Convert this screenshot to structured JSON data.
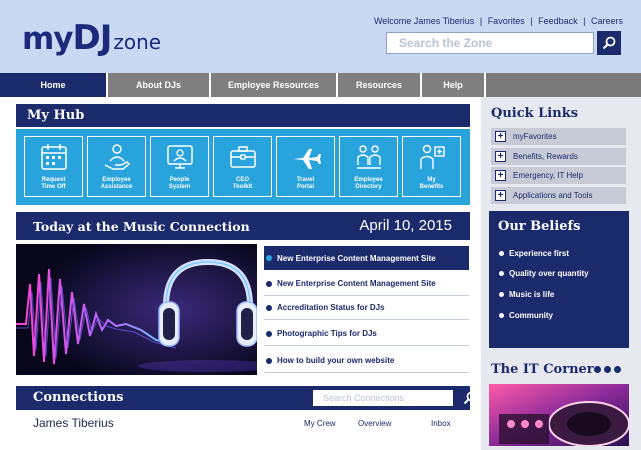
{
  "header": {
    "logo": {
      "my": "my",
      "dj": "DJ",
      "zone": "zone"
    },
    "welcome": "Welcome James Tiberius",
    "links": [
      "Favorites",
      "Feedback",
      "Careers"
    ],
    "search_placeholder": "Search the Zone"
  },
  "nav": {
    "items": [
      "Home",
      "About DJs",
      "Employee Resources",
      "Resources",
      "Help"
    ],
    "active": "Home"
  },
  "myhub": {
    "title": "My Hub",
    "tiles": [
      {
        "line1": "Request",
        "line2": "Time Off",
        "icon": "calendar-icon"
      },
      {
        "line1": "Employee",
        "line2": "Assistance",
        "icon": "helping-hand-icon"
      },
      {
        "line1": "People",
        "line2": "System",
        "icon": "people-system-icon"
      },
      {
        "line1": "CEO",
        "line2": "Toolkit",
        "icon": "toolkit-icon"
      },
      {
        "line1": "Travel",
        "line2": "Portal",
        "icon": "airplane-icon"
      },
      {
        "line1": "Employee",
        "line2": "Directory",
        "icon": "directory-icon"
      },
      {
        "line1": "My",
        "line2": "Benefits",
        "icon": "benefits-icon"
      }
    ]
  },
  "today": {
    "title": "Today at the Music Connection",
    "date": "April 10, 2015"
  },
  "news": [
    "New Enterprise Content Management Site",
    "New Enterprise Content Management Site",
    "Accreditation Status for DJs",
    "Photographic Tips for DJs",
    "How to build your own website"
  ],
  "connections": {
    "title": "Connections",
    "search_placeholder": "Search Connections",
    "name": "James Tiberius",
    "links": [
      "My Crew",
      "Overview",
      "Inbox"
    ]
  },
  "quick_links": {
    "title": "Quick Links",
    "items": [
      "myFavorites",
      "Benefits, Rewards",
      "Emergency, IT Help",
      "Applications and Tools"
    ]
  },
  "beliefs": {
    "title": "Our Beliefs",
    "items": [
      "Experience first",
      "Quality over quantity",
      "Music is life",
      "Community"
    ]
  },
  "it_corner": {
    "title": "The IT Corner"
  },
  "colors": {
    "navy": "#1b2a6b",
    "accent_blue": "#29a3dc",
    "header_bg": "#c9d9f4",
    "nav_gray": "#7f7f7f"
  }
}
